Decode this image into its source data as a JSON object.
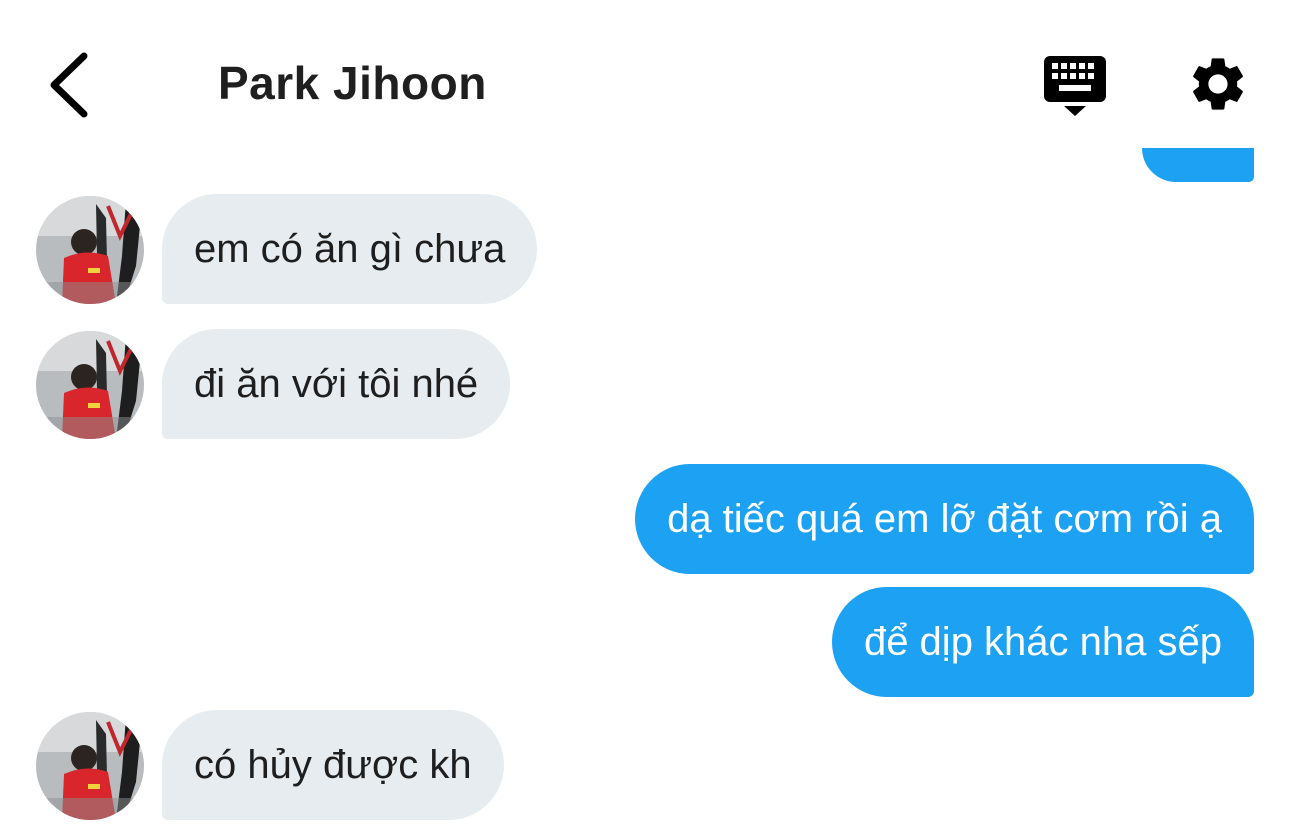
{
  "header": {
    "back_icon": "chevron-left-icon",
    "contact_name": "Park Jihoon",
    "keyboard_icon": "keyboard-icon",
    "settings_icon": "gear-icon"
  },
  "colors": {
    "sent_bubble": "#1da1f2",
    "received_bubble": "#e7ecf0",
    "received_text": "#1e1e1e",
    "sent_text": "#ffffff"
  },
  "messages": [
    {
      "direction": "in",
      "text": "em có ăn gì chưa"
    },
    {
      "direction": "in",
      "text": "đi ăn với tôi nhé"
    },
    {
      "direction": "out",
      "text": "dạ tiếc quá em lỡ đặt cơm rồi ạ"
    },
    {
      "direction": "out",
      "text": "để dịp khác nha sếp"
    },
    {
      "direction": "in",
      "text": "có hủy được kh"
    }
  ]
}
